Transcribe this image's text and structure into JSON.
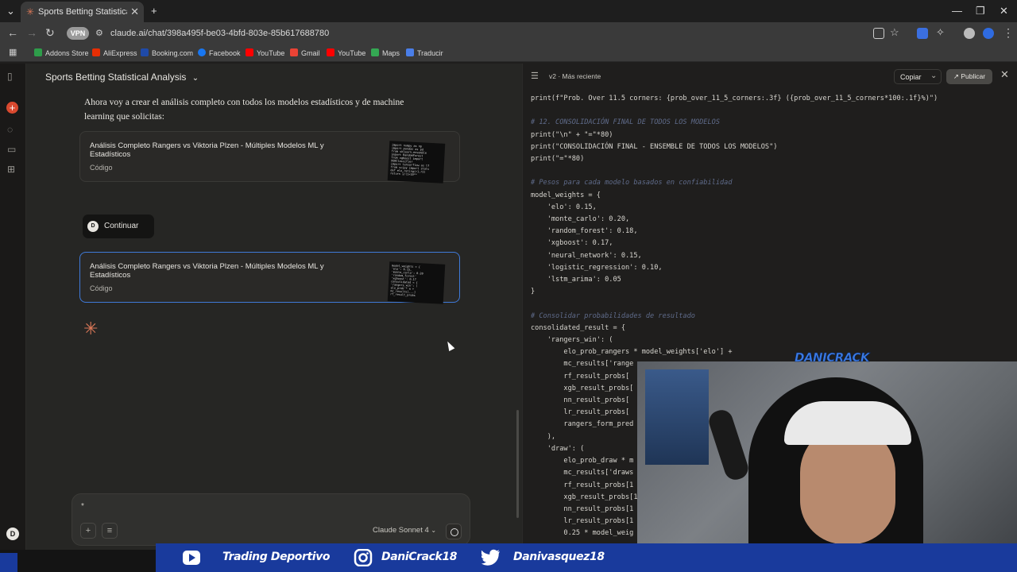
{
  "browser": {
    "tab_title": "Sports Betting Statistical Analysis",
    "tab_favicon": "claude-asterisk-icon",
    "url": "claude.ai/chat/398a495f-be03-4bfd-803e-85b617688780",
    "vpn_label": "VPN",
    "bookmarks": [
      {
        "label": "Addons Store",
        "color": "#2e9d4a"
      },
      {
        "label": "AliExpress",
        "color": "#e62e04"
      },
      {
        "label": "Booking.com",
        "color": "#1f4aa8"
      },
      {
        "label": "Facebook",
        "color": "#1877f2"
      },
      {
        "label": "YouTube",
        "color": "#ff0000"
      },
      {
        "label": "Gmail",
        "color": "#ea4335"
      },
      {
        "label": "YouTube",
        "color": "#ff0000"
      },
      {
        "label": "Maps",
        "color": "#34a853"
      },
      {
        "label": "Traducir",
        "color": "#4a7ee8"
      }
    ]
  },
  "chat": {
    "title": "Sports Betting Statistical Analysis",
    "intro": "Ahora voy a crear el análisis completo con todos los modelos estadísticos y de machine learning que solicitas:",
    "artifacts": [
      {
        "title": "Análisis Completo Rangers vs Viktoria Plzen - Múltiples Modelos ML y Estadísticos",
        "type": "Código"
      },
      {
        "title": "Análisis Completo Rangers vs Viktoria Plzen - Múltiples Modelos ML y Estadísticos",
        "type": "Código"
      }
    ],
    "continue_avatar": "D",
    "continue_label": "Continuar",
    "composer_placeholder": "*",
    "model": "Claude Sonnet 4",
    "user_avatar": "D"
  },
  "code_panel": {
    "version": "v2 · Más reciente",
    "copy_label": "Copiar",
    "publish_label": "Publicar",
    "lines": [
      {
        "t": "print(f\"Prob. Over 11.5 corners: {prob_over_11_5_corners:.3f} ({prob_over_11_5_corners*100:.1f}%)\")",
        "k": "code"
      },
      {
        "t": "",
        "k": "code"
      },
      {
        "t": "# 12. CONSOLIDACIÓN FINAL DE TODOS LOS MODELOS",
        "k": "comment"
      },
      {
        "t": "print(\"\\n\" + \"=\"*80)",
        "k": "code"
      },
      {
        "t": "print(\"CONSOLIDACIÓN FINAL - ENSEMBLE DE TODOS LOS MODELOS\")",
        "k": "code"
      },
      {
        "t": "print(\"=\"*80)",
        "k": "code"
      },
      {
        "t": "",
        "k": "code"
      },
      {
        "t": "# Pesos para cada modelo basados en confiabilidad",
        "k": "comment"
      },
      {
        "t": "model_weights = {",
        "k": "code"
      },
      {
        "t": "    'elo': 0.15,",
        "k": "code"
      },
      {
        "t": "    'monte_carlo': 0.20,",
        "k": "code"
      },
      {
        "t": "    'random_forest': 0.18,",
        "k": "code"
      },
      {
        "t": "    'xgboost': 0.17,",
        "k": "code"
      },
      {
        "t": "    'neural_network': 0.15,",
        "k": "code"
      },
      {
        "t": "    'logistic_regression': 0.10,",
        "k": "code"
      },
      {
        "t": "    'lstm_arima': 0.05",
        "k": "code"
      },
      {
        "t": "}",
        "k": "code"
      },
      {
        "t": "",
        "k": "code"
      },
      {
        "t": "# Consolidar probabilidades de resultado",
        "k": "comment"
      },
      {
        "t": "consolidated_result = {",
        "k": "code"
      },
      {
        "t": "    'rangers_win': (",
        "k": "code"
      },
      {
        "t": "        elo_prob_rangers * model_weights['elo'] +",
        "k": "code"
      },
      {
        "t": "        mc_results['range",
        "k": "code"
      },
      {
        "t": "        rf_result_probs[",
        "k": "code"
      },
      {
        "t": "        xgb_result_probs[",
        "k": "code"
      },
      {
        "t": "        nn_result_probs[",
        "k": "code"
      },
      {
        "t": "        lr_result_probs[",
        "k": "code"
      },
      {
        "t": "        rangers_form_pred",
        "k": "code"
      },
      {
        "t": "    ),",
        "k": "code"
      },
      {
        "t": "    'draw': (",
        "k": "code"
      },
      {
        "t": "        elo_prob_draw * m",
        "k": "code"
      },
      {
        "t": "        mc_results['draws",
        "k": "code"
      },
      {
        "t": "        rf_result_probs[1",
        "k": "code"
      },
      {
        "t": "        xgb_result_probs[1",
        "k": "code"
      },
      {
        "t": "        nn_result_probs[1",
        "k": "code"
      },
      {
        "t": "        lr_result_probs[1",
        "k": "code"
      },
      {
        "t": "        0.25 * model_weig",
        "k": "code"
      }
    ]
  },
  "stream": {
    "webcam_label": "DANICRACK",
    "socials": [
      {
        "icon": "youtube-icon",
        "label": "Trading Deportivo"
      },
      {
        "icon": "instagram-icon",
        "label": "DaniCrack18"
      },
      {
        "icon": "twitter-icon",
        "label": "Danivasquez18"
      }
    ]
  },
  "colors": {
    "accent": "#d97757",
    "selected_border": "#3f7ad9",
    "overlay_blue": "#193a9c"
  }
}
